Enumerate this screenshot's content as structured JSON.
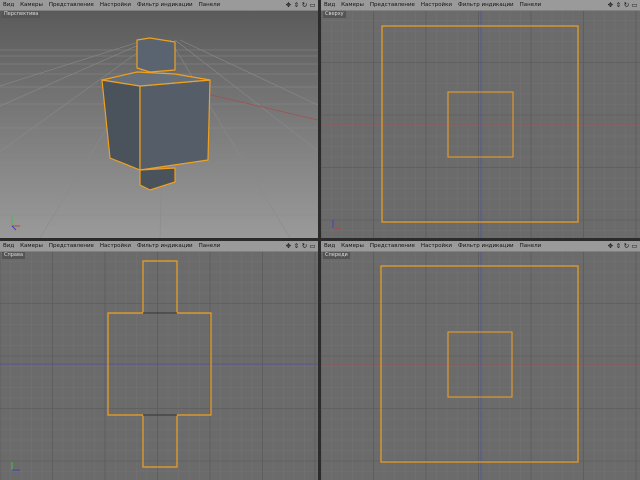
{
  "viewports": [
    {
      "id": "perspective",
      "label": "Перспектива",
      "menu": [
        "Вид",
        "Камеры",
        "Представление",
        "Настройки",
        "Фильтр индикации",
        "Панели"
      ],
      "nav_icons": [
        "move-view-icon",
        "zoom-view-icon",
        "rotate-view-icon",
        "maximize-view-icon"
      ]
    },
    {
      "id": "top",
      "label": "Сверху",
      "menu": [
        "Вид",
        "Камеры",
        "Представление",
        "Настройки",
        "Фильтр индикации",
        "Панели"
      ],
      "nav_icons": [
        "move-view-icon",
        "zoom-view-icon",
        "rotate-view-icon",
        "maximize-view-icon"
      ]
    },
    {
      "id": "right",
      "label": "Справа",
      "menu": [
        "Вид",
        "Камеры",
        "Представление",
        "Настройки",
        "Фильтр индикации",
        "Панели"
      ],
      "nav_icons": [
        "move-view-icon",
        "zoom-view-icon",
        "rotate-view-icon",
        "maximize-view-icon"
      ]
    },
    {
      "id": "front",
      "label": "Спереди",
      "menu": [
        "Вид",
        "Камеры",
        "Представление",
        "Настройки",
        "Фильтр индикации",
        "Панели"
      ],
      "nav_icons": [
        "move-view-icon",
        "zoom-view-icon",
        "rotate-view-icon",
        "maximize-view-icon"
      ]
    }
  ],
  "colors": {
    "viewport_bg": "#6b6b6b",
    "grid_line": "#757575",
    "grid_major": "#5a5a5a",
    "selection_outline": "#f0a020",
    "axis_x": "#a04040",
    "axis_z": "#4040a0",
    "object_face_dark": "#4a525c",
    "object_face_light": "#5c6670"
  }
}
